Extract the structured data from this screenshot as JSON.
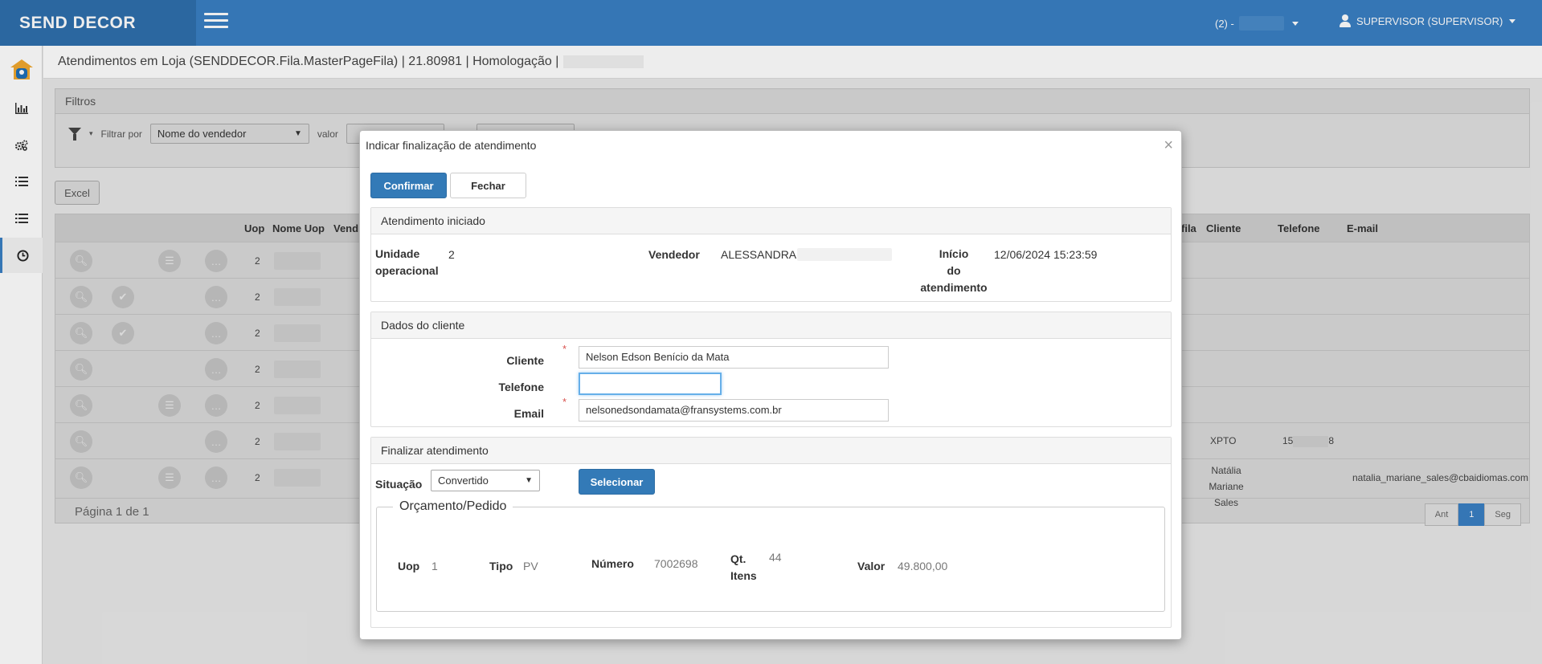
{
  "app": {
    "brand": "SEND DECOR",
    "branch_label": "(2) -",
    "user_label": "SUPERVISOR (SUPERVISOR)"
  },
  "sidebar": {
    "items": [
      {
        "icon": "home-logo-icon"
      },
      {
        "icon": "bar-chart-icon",
        "glyph": "📊"
      },
      {
        "icon": "gears-icon",
        "glyph": "⚙"
      },
      {
        "icon": "list-icon",
        "glyph": "☰"
      },
      {
        "icon": "list-alt-icon",
        "glyph": "☰"
      },
      {
        "icon": "clock-icon",
        "glyph": "◷"
      }
    ]
  },
  "page": {
    "title": "Atendimentos em Loja (SENDDECOR.Fila.MasterPageFila) | 21.80981 | Homologação |"
  },
  "filters": {
    "heading": "Filtros",
    "filter_by_label": "Filtrar por",
    "filter_by_value": "Nome do vendedor",
    "value_label": "valor"
  },
  "toolbar": {
    "excel_label": "Excel"
  },
  "grid": {
    "columns": {
      "uop": "Uop",
      "nome_uop": "Nome Uop",
      "vend": "Vend",
      "fila": "fila",
      "cliente": "Cliente",
      "telefone": "Telefone",
      "email": "E-mail"
    },
    "rows": [
      {
        "uop": "2",
        "cliente": "",
        "telefone": "",
        "email": ""
      },
      {
        "uop": "2",
        "cliente": "",
        "telefone": "",
        "email": ""
      },
      {
        "uop": "2",
        "cliente": "",
        "telefone": "",
        "email": ""
      },
      {
        "uop": "2",
        "cliente": "",
        "telefone": "",
        "email": ""
      },
      {
        "uop": "2",
        "cliente": "",
        "telefone": "",
        "email": ""
      },
      {
        "uop": "2",
        "cliente": "XPTO",
        "telefone": "15",
        "telefone_end": "8",
        "email": ""
      },
      {
        "uop": "2",
        "cliente": "Natália Mariane Sales",
        "telefone": "",
        "email": "natalia_mariane_sales@cbaidiomas.com"
      }
    ],
    "footer": "Página 1 de 1",
    "pager": {
      "prev": "Ant",
      "current": "1",
      "next": "Seg"
    }
  },
  "modal": {
    "title": "Indicar finalização de atendimento",
    "close_glyph": "×",
    "confirm_label": "Confirmar",
    "close_label": "Fechar",
    "started": {
      "heading": "Atendimento iniciado",
      "unit_label_1": "Unidade",
      "unit_label_2": "operacional",
      "unit_value": "2",
      "seller_label": "Vendedor",
      "seller_value": "ALESSANDRA",
      "start_label_1": "Início",
      "start_label_2": "do",
      "start_label_3": "atendimento",
      "start_value": "12/06/2024 15:23:59"
    },
    "client": {
      "heading": "Dados do cliente",
      "name_label": "Cliente",
      "name_value": "Nelson Edson Benício da Mata",
      "phone_label": "Telefone",
      "phone_value": "",
      "email_label": "Email",
      "email_value": "nelsonedsondamata@fransystems.com.br",
      "required_mark": "*"
    },
    "finish": {
      "heading": "Finalizar atendimento",
      "situation_label": "Situação",
      "situation_value": "Convertido",
      "select_label": "Selecionar",
      "order": {
        "legend": "Orçamento/Pedido",
        "uop_label": "Uop",
        "uop_value": "1",
        "tipo_label": "Tipo",
        "tipo_value": "PV",
        "numero_label": "Número",
        "numero_value": "7002698",
        "qt_label_1": "Qt.",
        "qt_label_2": "Itens",
        "qt_value": "44",
        "valor_label": "Valor",
        "valor_value": "49.800,00"
      }
    }
  },
  "colors": {
    "topbar": "#3a7fc3",
    "brand_bg": "#2f6fad",
    "primary": "#337ab7",
    "required": "#d9534f"
  }
}
